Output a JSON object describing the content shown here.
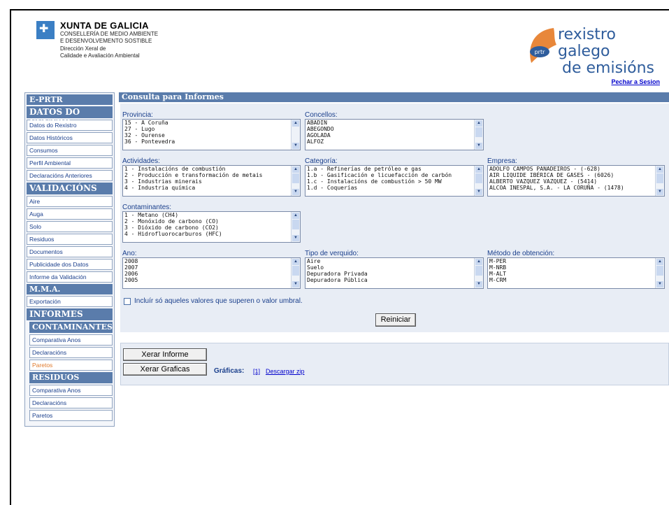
{
  "header": {
    "org_title": "XUNTA DE GALICIA",
    "org_line1": "CONSELLERÍA DE MEDIO AMBIENTE",
    "org_line2": "E DESENVOLVEMENTO SOSTIBLE",
    "org_line3": "Dirección Xeral de",
    "org_line4": "Calidade e Avaliación Ambiental",
    "brand_line1": "rexistro galego",
    "brand_line2": "de emisións",
    "brand_badge": "prtr",
    "logout": "Pechar a Sesion"
  },
  "sidebar": {
    "title": "E-PRTR",
    "datos_centro": "DATOS DO CENTRO",
    "datos_items": [
      "Datos do Rexistro",
      "Datos Históricos",
      "Consumos",
      "Perfil Ambiental",
      "Declaracións Anteriores"
    ],
    "validacions": "VALIDACIÓNS",
    "validacion_items": [
      "Aire",
      "Auga",
      "Solo",
      "Residuos",
      "Documentos",
      "Publicidade dos Datos",
      "Informe da Validación"
    ],
    "mma": "M.M.A.",
    "mma_items": [
      "Exportación"
    ],
    "informes": "INFORMES",
    "contaminantes": "CONTAMINANTES",
    "contaminantes_items": [
      "Comparativa Anos",
      "Declaracións",
      "Paretos"
    ],
    "residuos": "RESIDUOS",
    "residuos_items": [
      "Comparativa Anos",
      "Declaracións",
      "Paretos"
    ]
  },
  "main": {
    "title": "Consulta para Informes",
    "provincia": {
      "label": "Provincia:",
      "options": [
        "15 - A Coruña",
        "27 - Lugo",
        "32 - Ourense",
        "36 - Pontevedra"
      ]
    },
    "concellos": {
      "label": "Concellos:",
      "options": [
        "ABADIN",
        "ABEGONDO",
        "AGOLADA",
        "ALFOZ"
      ]
    },
    "actividades": {
      "label": "Actividades:",
      "options": [
        "1 - Instalacións de combustión",
        "2 - Producción e transformación de metais",
        "3 - Industrias minerais",
        "4 - Industria química"
      ]
    },
    "categoria": {
      "label": "Categoría:",
      "options": [
        "1.a - Refinerías de petróleo e gas",
        "1.b - Gasificación e licuefacción de carbón",
        "1.c - Instalacións de combustión > 50 MW",
        "1.d - Coquerías"
      ]
    },
    "empresa": {
      "label": "Empresa:",
      "options": [
        "ADOLFO CAMPOS PANADEIROS - (-628)",
        "AIR LIQUIDE IBÉRICA DE GASES - (6026)",
        "ALBERTO VAZQUEZ VAZQUEZ - (5414)",
        "ALCOA INESPAL, S.A. - LA CORUÑA - (1478)"
      ]
    },
    "contaminantes": {
      "label": "Contaminantes:",
      "options": [
        "1 - Metano (CH4)",
        "2 - Monóxido de carbono (CO)",
        "3 - Dióxido de carbono (CO2)",
        "4 - Hidrofluorocarburos (HFC)"
      ]
    },
    "ano": {
      "label": "Ano:",
      "options": [
        "2008",
        "2007",
        "2006",
        "2005"
      ]
    },
    "verquido": {
      "label": "Tipo de verquido:",
      "options": [
        "Aire",
        "Suelo",
        "Depuradora Privada",
        "Depuradora Pública"
      ]
    },
    "metodo": {
      "label": "Método de obtención:",
      "options": [
        "M-PER",
        "M-NRB",
        "M-ALT",
        "M-CRM"
      ]
    },
    "umbral_label": "Incluír só aqueles valores que superen o valor umbral.",
    "reset_button": "Reiniciar",
    "xerar_informe": "Xerar Informe",
    "xerar_graficas": "Xerar Graficas",
    "graficas_label": "Gráficas:",
    "graficas_link1": "[1]",
    "graficas_link2": "Descargar zip"
  },
  "colors": {
    "nav_header": "#5a7cab",
    "panel_bg": "#e8edf5",
    "link": "#0000cc",
    "active_item": "#e07a2c"
  }
}
